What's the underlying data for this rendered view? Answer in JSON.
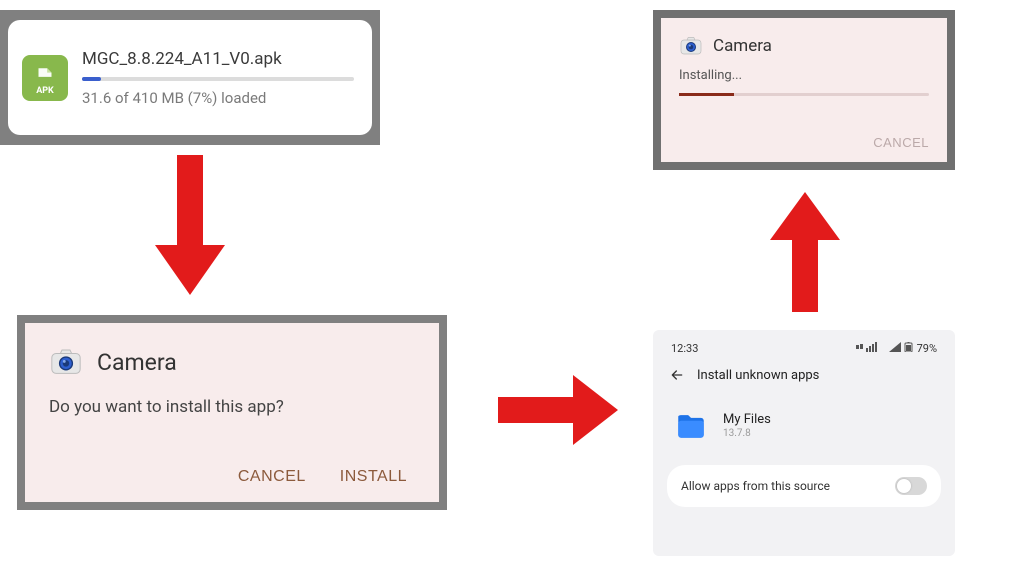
{
  "download": {
    "filename": "MGC_8.8.224_A11_V0.apk",
    "status_text": "31.6 of 410 MB (7%) loaded",
    "progress_percent": 7,
    "apk_label": "APK"
  },
  "install_prompt": {
    "app_name": "Camera",
    "question": "Do you want to install this app?",
    "cancel_label": "CANCEL",
    "install_label": "INSTALL"
  },
  "settings": {
    "time": "12:33",
    "battery": "79%",
    "page_title": "Install unknown apps",
    "app_name": "My Files",
    "app_version": "13.7.8",
    "toggle_label": "Allow apps from this source",
    "toggle_on": false
  },
  "installing": {
    "app_name": "Camera",
    "status_text": "Installing...",
    "progress_percent": 22,
    "cancel_label": "CANCEL"
  },
  "colors": {
    "arrow": "#e21b1b",
    "apk_green": "#88b84c",
    "download_blue": "#3a5fcd",
    "install_accent": "#8c5a3c",
    "installing_bar": "#8a2b1a",
    "files_blue": "#1e73e8"
  }
}
